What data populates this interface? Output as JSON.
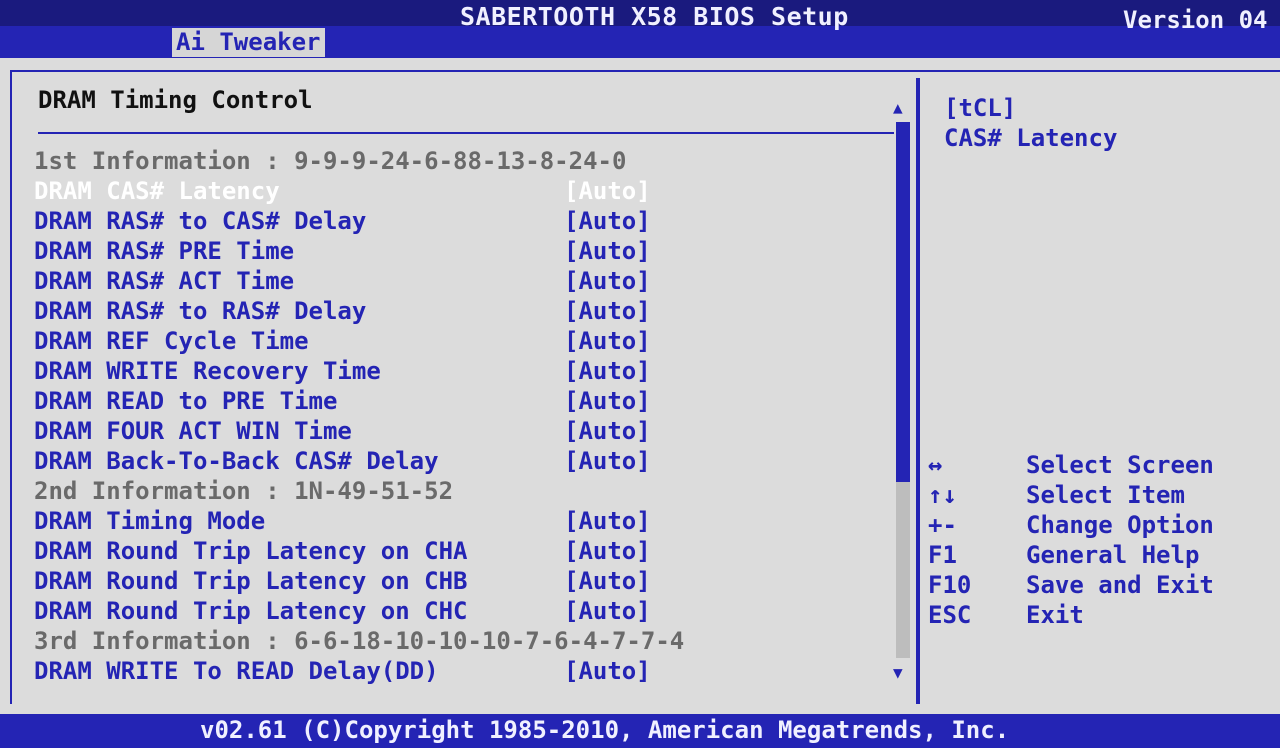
{
  "header": {
    "title": "SABERTOOTH X58 BIOS Setup",
    "version": "Version 04",
    "active_tab": "Ai Tweaker"
  },
  "section": {
    "title": "DRAM Timing Control"
  },
  "rows": [
    {
      "type": "info",
      "label": "1st Information : 9-9-9-24-6-88-13-8-24-0",
      "value": ""
    },
    {
      "type": "setting",
      "label": "DRAM CAS# Latency",
      "value": "[Auto]",
      "selected": true
    },
    {
      "type": "setting",
      "label": "DRAM RAS# to CAS# Delay",
      "value": "[Auto]"
    },
    {
      "type": "setting",
      "label": "DRAM RAS# PRE Time",
      "value": "[Auto]"
    },
    {
      "type": "setting",
      "label": "DRAM RAS# ACT Time",
      "value": "[Auto]"
    },
    {
      "type": "setting",
      "label": "DRAM RAS# to RAS# Delay",
      "value": "[Auto]"
    },
    {
      "type": "setting",
      "label": "DRAM REF Cycle Time",
      "value": "[Auto]"
    },
    {
      "type": "setting",
      "label": "DRAM WRITE Recovery Time",
      "value": "[Auto]"
    },
    {
      "type": "setting",
      "label": "DRAM READ to PRE Time",
      "value": "[Auto]"
    },
    {
      "type": "setting",
      "label": "DRAM FOUR ACT WIN Time",
      "value": "[Auto]"
    },
    {
      "type": "setting",
      "label": "DRAM Back-To-Back CAS# Delay",
      "value": "[Auto]"
    },
    {
      "type": "info",
      "label": "2nd Information : 1N-49-51-52",
      "value": ""
    },
    {
      "type": "setting",
      "label": "DRAM Timing Mode",
      "value": "[Auto]"
    },
    {
      "type": "setting",
      "label": "DRAM Round Trip Latency on CHA",
      "value": "[Auto]"
    },
    {
      "type": "setting",
      "label": "DRAM Round Trip Latency on CHB",
      "value": "[Auto]"
    },
    {
      "type": "setting",
      "label": "DRAM Round Trip Latency on CHC",
      "value": "[Auto]"
    },
    {
      "type": "info",
      "label": "3rd Information : 6-6-18-10-10-10-7-6-4-7-7-4",
      "value": ""
    },
    {
      "type": "setting",
      "label": "DRAM WRITE To READ Delay(DD)",
      "value": "[Auto]"
    }
  ],
  "scroll": {
    "up_glyph": "▲",
    "down_glyph": "▼"
  },
  "help": {
    "title": "[tCL]",
    "description": "CAS# Latency"
  },
  "keys": [
    {
      "key": "↔",
      "action": "Select Screen",
      "icon": "left-right-arrow-icon"
    },
    {
      "key": "↑↓",
      "action": "Select Item",
      "icon": "up-down-arrow-icon"
    },
    {
      "key": "+-",
      "action": "Change Option",
      "icon": "plus-minus-icon"
    },
    {
      "key": "F1",
      "action": "General Help"
    },
    {
      "key": "F10",
      "action": "Save and Exit"
    },
    {
      "key": "ESC",
      "action": "Exit"
    }
  ],
  "footer": {
    "copyright": "v02.61 (C)Copyright 1985-2010, American Megatrends, Inc."
  },
  "colors": {
    "bios_blue": "#2424b4",
    "background": "#dcdcdc",
    "info_gray": "#6a6a6a",
    "selected_white": "#ffffff"
  }
}
